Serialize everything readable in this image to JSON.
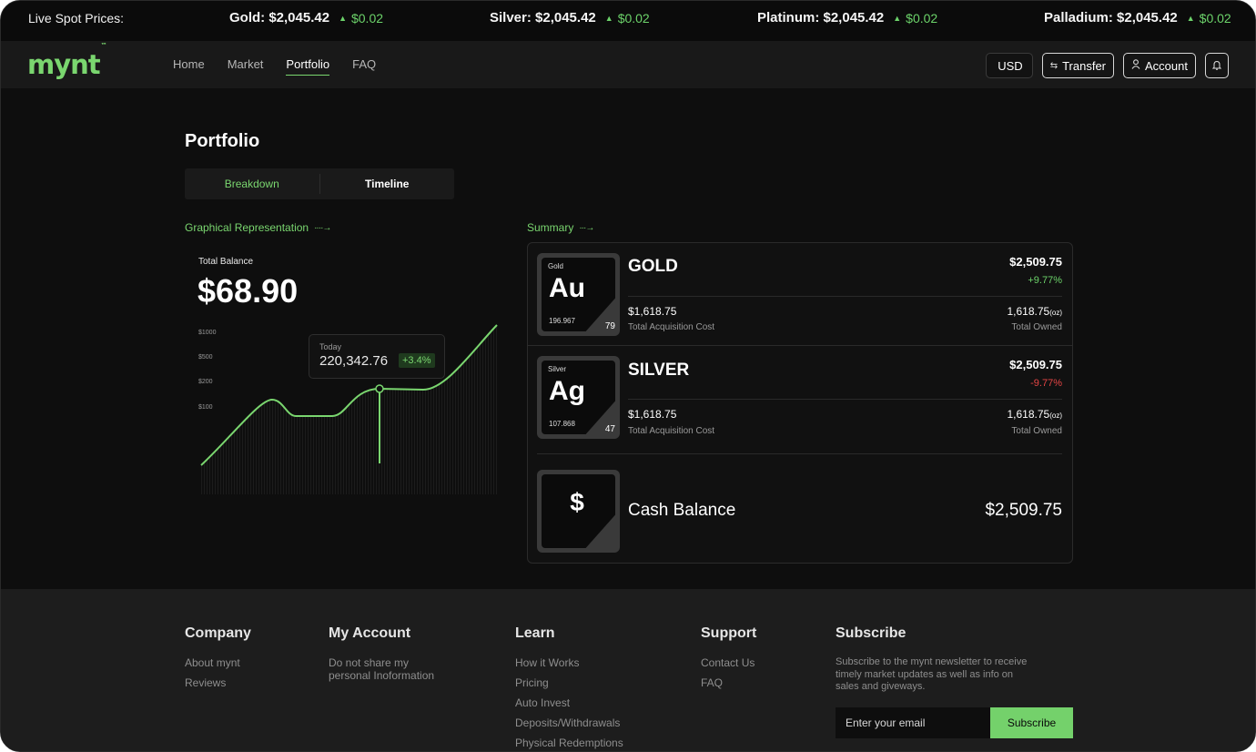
{
  "ticker": {
    "label": "Live Spot Prices:",
    "items": [
      {
        "name": "Gold: $2,045.42",
        "change": "$0.02"
      },
      {
        "name": "Silver: $2,045.42",
        "change": "$0.02"
      },
      {
        "name": "Platinum: $2,045.42",
        "change": "$0.02"
      },
      {
        "name": "Palladium: $2,045.42",
        "change": "$0.02"
      }
    ],
    "up_color": "#6cd36a"
  },
  "nav": {
    "logo": "mynt",
    "logo_tm": "™",
    "links": [
      "Home",
      "Market",
      "Portfolio",
      "FAQ"
    ],
    "active": "Portfolio",
    "currency": "USD",
    "transfer": "Transfer",
    "account": "Account",
    "icons": {
      "transfer": "swap-arrows-icon",
      "account": "user-icon",
      "bell": "bell-icon"
    }
  },
  "page": {
    "title": "Portfolio",
    "tabs": {
      "breakdown": "Breakdown",
      "timeline": "Timeline"
    }
  },
  "graph": {
    "heading": "Graphical Representation",
    "total_label": "Total Balance",
    "total_value": "$68.90",
    "y_ticks": [
      "$1000",
      "$500",
      "$200",
      "$100"
    ],
    "tooltip": {
      "label": "Today",
      "value": "220,342.76",
      "change": "+3.4%"
    }
  },
  "summary": {
    "heading": "Summary",
    "metals": [
      {
        "card_name": "Gold",
        "symbol": "Au",
        "weight": "196.967",
        "number": "79",
        "name": "GOLD",
        "value": "$2,509.75",
        "change": "+9.77%",
        "change_color": "#6cd36a",
        "acq_value": "$1,618.75",
        "acq_label": "Total Acquisition Cost",
        "owned_value": "1,618.75",
        "owned_unit": "(oz)",
        "owned_label": "Total Owned"
      },
      {
        "card_name": "Silver",
        "symbol": "Ag",
        "weight": "107.868",
        "number": "47",
        "name": "SILVER",
        "value": "$2,509.75",
        "change": "-9.77%",
        "change_color": "#e64545",
        "acq_value": "$1,618.75",
        "acq_label": "Total Acquisition Cost",
        "owned_value": "1,618.75",
        "owned_unit": "(oz)",
        "owned_label": "Total Owned"
      }
    ],
    "cash": {
      "symbol": "$",
      "label": "Cash Balance",
      "value": "$2,509.75"
    }
  },
  "footer": {
    "company": {
      "title": "Company",
      "links": [
        "About mynt",
        "Reviews"
      ]
    },
    "account": {
      "title": "My Account",
      "links": [
        "Do not share my personal Inoformation"
      ]
    },
    "learn": {
      "title": "Learn",
      "links": [
        "How it Works",
        "Pricing",
        "Auto Invest",
        "Deposits/Withdrawals",
        "Physical Redemptions"
      ]
    },
    "support": {
      "title": "Support",
      "links": [
        "Contact Us",
        "FAQ"
      ]
    },
    "subscribe": {
      "title": "Subscribe",
      "text": "Subscribe to the mynt newsletter to receive timely market updates as well as info on sales and giveways.",
      "placeholder": "Enter your email",
      "button": "Subscribe"
    }
  },
  "colors": {
    "accent": "#7ad66f",
    "negative": "#e64545",
    "bg": "#0e0e0e"
  }
}
